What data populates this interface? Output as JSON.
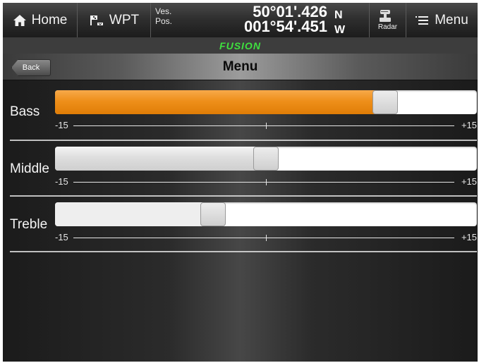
{
  "topbar": {
    "home_label": "Home",
    "wpt_label": "WPT",
    "pos_label_line1": "Ves.",
    "pos_label_line2": "Pos.",
    "lat": "50°01'.426",
    "lat_hemi": "N",
    "lon": "001°54'.451",
    "lon_hemi": "W",
    "radar_label": "Radar",
    "menu_label": "Menu"
  },
  "brand": {
    "logo_text": "FUSION",
    "logo_color": "#3fe13f"
  },
  "header": {
    "back_label": "Back",
    "title": "Menu"
  },
  "sliders": [
    {
      "label": "Bass",
      "min_label": "-15",
      "max_label": "+15",
      "value": 9,
      "min": -15,
      "max": 15,
      "active": true
    },
    {
      "label": "Middle",
      "min_label": "-15",
      "max_label": "+15",
      "value": 0,
      "min": -15,
      "max": 15,
      "active": false
    },
    {
      "label": "Treble",
      "min_label": "-15",
      "max_label": "+15",
      "value": -4,
      "min": -15,
      "max": 15,
      "active": false
    }
  ],
  "colors": {
    "accent": "#ee8f1a",
    "background": "#2b2b2b"
  }
}
